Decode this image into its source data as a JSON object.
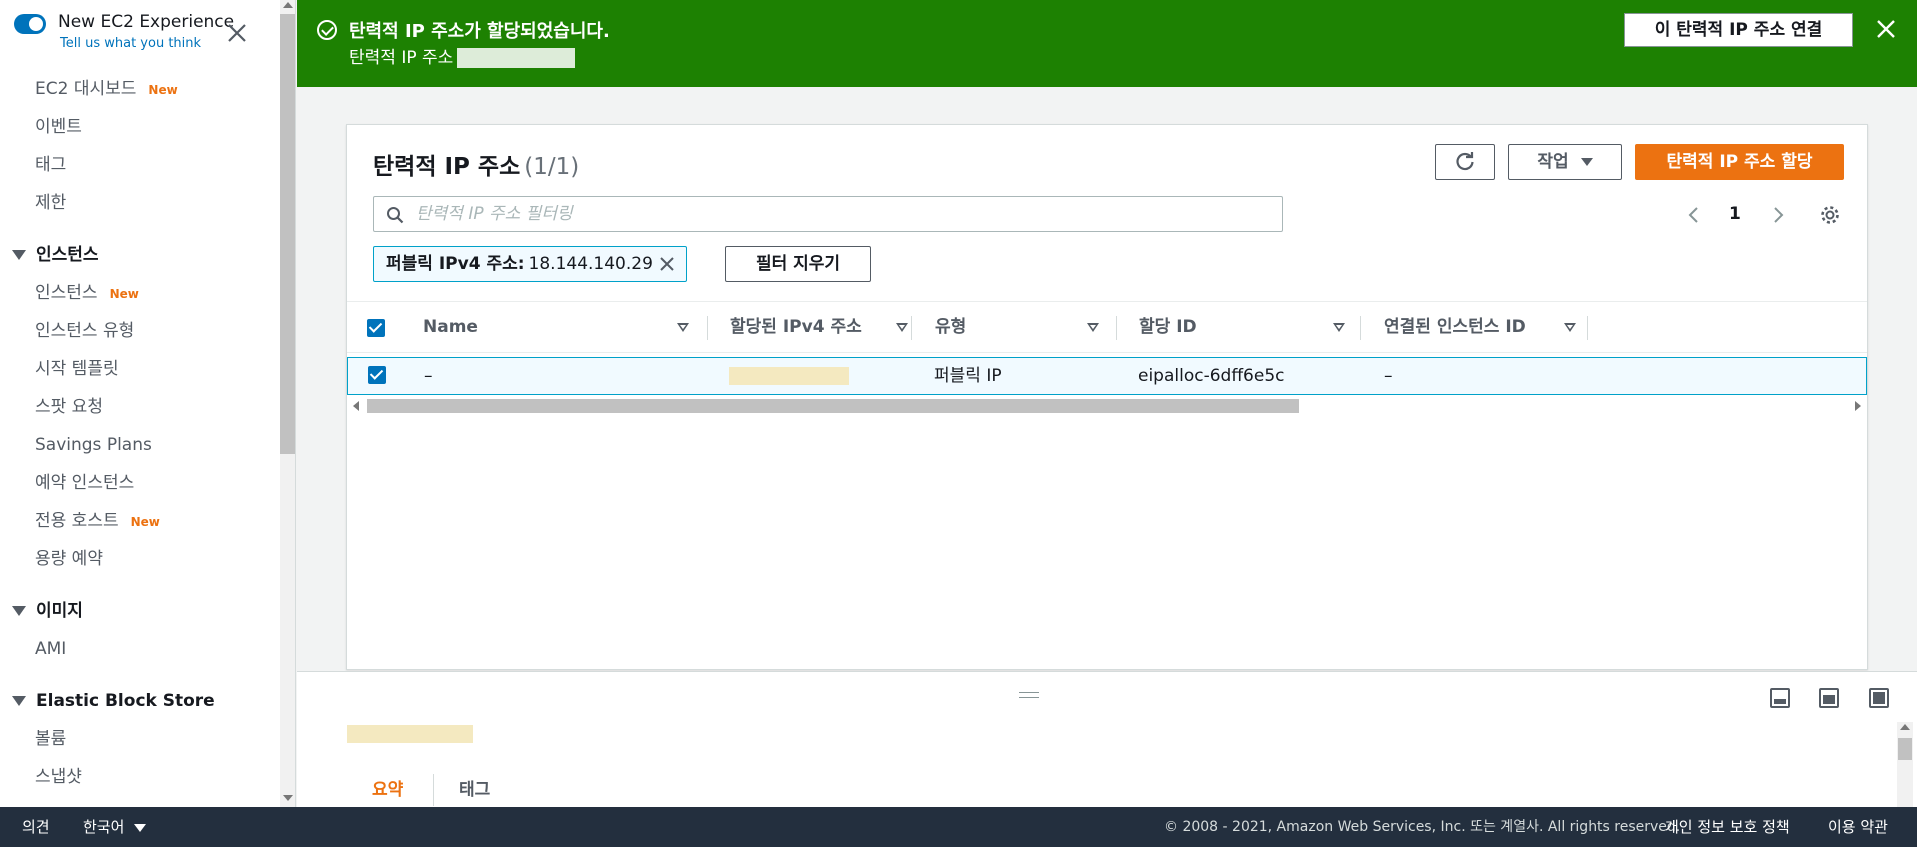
{
  "sidebar": {
    "toggle_title": "New EC2 Experience",
    "feedback_link": "Tell us what you think",
    "new_badge": "New",
    "items_top": [
      {
        "label": "EC2 대시보드",
        "new": true
      },
      {
        "label": "이벤트",
        "new": false
      },
      {
        "label": "태그",
        "new": false
      },
      {
        "label": "제한",
        "new": false
      }
    ],
    "sections": [
      {
        "title": "인스턴스",
        "items": [
          {
            "label": "인스턴스",
            "new": true
          },
          {
            "label": "인스턴스 유형",
            "new": false
          },
          {
            "label": "시작 템플릿",
            "new": false
          },
          {
            "label": "스팟 요청",
            "new": false
          },
          {
            "label": "Savings Plans",
            "new": false
          },
          {
            "label": "예약 인스턴스",
            "new": false
          },
          {
            "label": "전용 호스트",
            "new": true
          },
          {
            "label": "용량 예약",
            "new": false
          }
        ]
      },
      {
        "title": "이미지",
        "items": [
          {
            "label": "AMI",
            "new": false
          }
        ]
      },
      {
        "title": "Elastic Block Store",
        "items": [
          {
            "label": "볼륨",
            "new": false
          },
          {
            "label": "스냅샷",
            "new": false
          }
        ]
      }
    ]
  },
  "banner": {
    "title": "탄력적 IP 주소가 할당되었습니다.",
    "subtitle": "탄력적 IP 주소",
    "button": "이 탄력적 IP 주소 연결",
    "color": "#1d8102"
  },
  "panel": {
    "title": "탄력적 IP 주소",
    "count": "(1/1)",
    "actions_label": "작업",
    "allocate_label": "탄력적 IP 주소 할당",
    "search_placeholder": "탄력적 IP 주소 필터링",
    "page_number": "1",
    "filter_token": {
      "key": "퍼블릭 IPv4 주소:",
      "value": "18.144.140.29"
    },
    "clear_filters": "필터 지우기"
  },
  "table": {
    "columns": [
      "Name",
      "할당된 IPv4 주소",
      "유형",
      "할당 ID",
      "연결된 인스턴스 ID"
    ],
    "rows": [
      {
        "name": "–",
        "ipv4": "",
        "type": "퍼블릭 IP",
        "allocation_id": "eipalloc-6dff6e5c",
        "instance_id": "–",
        "selected": true
      }
    ]
  },
  "details": {
    "tabs": [
      "요약",
      "태그"
    ],
    "active_tab": "요약"
  },
  "footer": {
    "feedback": "의견",
    "language": "한국어",
    "copyright": "© 2008 - 2021, Amazon Web Services, Inc. 또는 계열사. All rights reserved.",
    "privacy": "개인 정보 보호 정책",
    "terms": "이용 약관"
  },
  "colors": {
    "accent": "#ec7211",
    "link": "#0073bb",
    "success": "#1d8102",
    "footer_bg": "#232f3e"
  }
}
